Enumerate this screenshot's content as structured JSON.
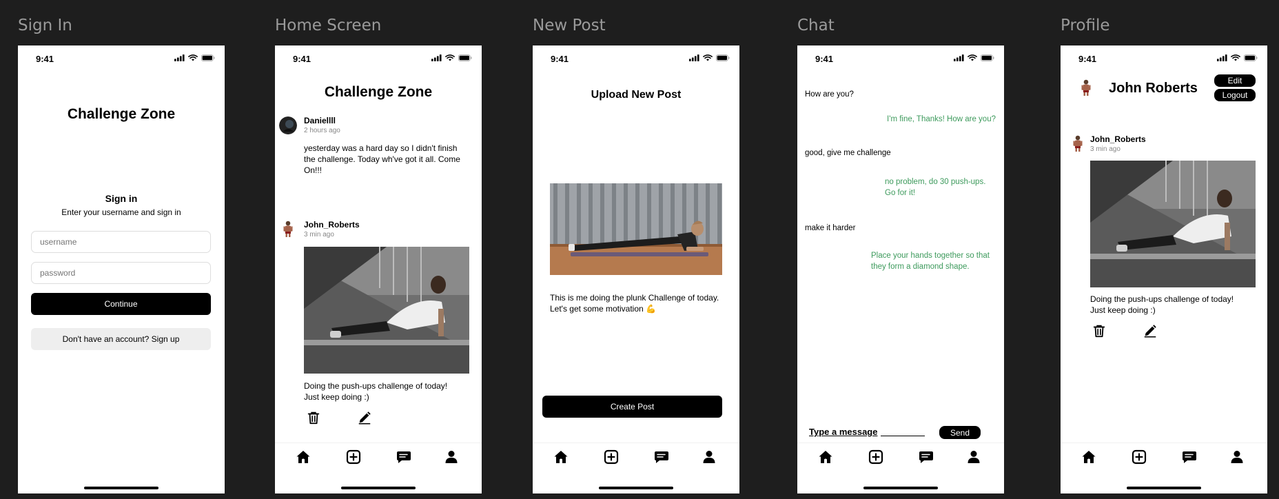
{
  "frames": {
    "signin": "Sign In",
    "home": "Home Screen",
    "newpost": "New Post",
    "chat": "Chat",
    "profile": "Profile"
  },
  "status_time": "9:41",
  "signin": {
    "app_title": "Challenge Zone",
    "heading": "Sign in",
    "subheading": "Enter your username and sign in",
    "username_placeholder": "username",
    "password_placeholder": "password",
    "continue_label": "Continue",
    "signup_label": "Don't have an account? Sign up"
  },
  "home": {
    "app_title": "Challenge Zone",
    "posts": [
      {
        "author": "Daniellll",
        "time": "2 hours ago",
        "text": "yesterday was a hard day so I didn't finish the challenge. Today wh've got it all. Come On!!!"
      },
      {
        "author": "John_Roberts",
        "time": "3 min ago",
        "text": "Doing the push-ups challenge of today! Just keep doing :)"
      }
    ]
  },
  "newpost": {
    "title": "Upload New Post",
    "caption": "This is me doing the plunk Challenge of today. Let's get some motivation 💪",
    "create_label": "Create Post"
  },
  "chat": {
    "messages": [
      {
        "side": "left",
        "text": "How are you?"
      },
      {
        "side": "right",
        "text": "I'm fine, Thanks! How are you?"
      },
      {
        "side": "left",
        "text": "good, give me challenge"
      },
      {
        "side": "right",
        "text": "no problem, do 30 push-ups. Go for it!"
      },
      {
        "side": "left",
        "text": "make it harder"
      },
      {
        "side": "right",
        "text": "Place your hands together so that they form a diamond shape."
      }
    ],
    "input_placeholder": "Type a message",
    "send_label": "Send"
  },
  "profile": {
    "name": "John Roberts",
    "edit_label": "Edit",
    "logout_label": "Logout",
    "post": {
      "author": "John_Roberts",
      "time": "3 min ago",
      "text": "Doing the push-ups challenge of today! Just keep doing :)"
    }
  },
  "colors": {
    "background": "#1e1e1e",
    "accent_green": "#3d9a5c",
    "button_black": "#000000",
    "label_gray": "#9a9a9a"
  },
  "icons": [
    "home-icon",
    "add-square-icon",
    "chat-bubble-icon",
    "person-icon",
    "trash-icon",
    "pencil-icon",
    "signal-icon",
    "wifi-icon",
    "battery-icon"
  ]
}
